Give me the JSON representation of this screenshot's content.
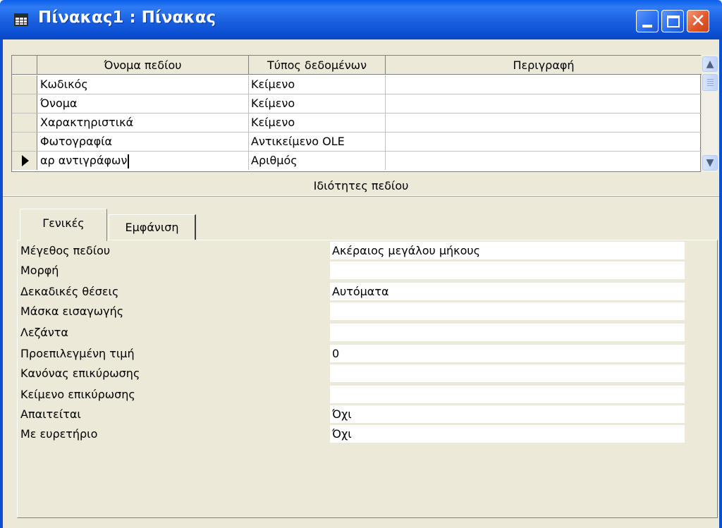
{
  "window": {
    "title": "Πίνακας1 : Πίνακας",
    "close_glyph": "✕"
  },
  "grid": {
    "columns": [
      "Όνομα πεδίου",
      "Τύπος δεδομένων",
      "Περιγραφή"
    ],
    "rows": [
      {
        "name": "Κωδικός",
        "type": "Κείμενο",
        "description": ""
      },
      {
        "name": "Όνομα",
        "type": "Κείμενο",
        "description": ""
      },
      {
        "name": "Χαρακτηριστικά",
        "type": "Κείμενο",
        "description": ""
      },
      {
        "name": "Φωτογραφία",
        "type": "Αντικείμενο OLE",
        "description": ""
      },
      {
        "name": "αρ αντιγράφων",
        "type": "Αριθμός",
        "description": ""
      }
    ],
    "current_row": 4
  },
  "properties": {
    "title": "Ιδιότητες πεδίου",
    "tabs": [
      "Γενικές",
      "Εμφάνιση"
    ],
    "active_tab": "Γενικές",
    "items": [
      {
        "label": "Μέγεθος πεδίου",
        "value": "Ακέραιος μεγάλου μήκους"
      },
      {
        "label": "Μορφή",
        "value": ""
      },
      {
        "label": "Δεκαδικές θέσεις",
        "value": "Αυτόματα"
      },
      {
        "label": "Μάσκα εισαγωγής",
        "value": ""
      },
      {
        "label": "Λεζάντα",
        "value": ""
      },
      {
        "label": "Προεπιλεγμένη τιμή",
        "value": "0"
      },
      {
        "label": "Κανόνας επικύρωσης",
        "value": ""
      },
      {
        "label": "Κείμενο επικύρωσης",
        "value": ""
      },
      {
        "label": "Απαιτείται",
        "value": "Όχι"
      },
      {
        "label": "Με ευρετήριο",
        "value": "Όχι"
      }
    ]
  },
  "colors": {
    "titlebar": "#0c4fd3",
    "frame": "#ece9d8",
    "close_button": "#e2582f"
  }
}
